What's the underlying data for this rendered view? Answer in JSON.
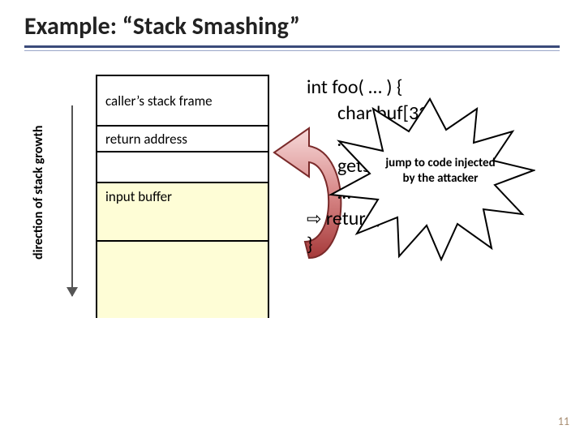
{
  "title": "Example: “Stack Smashing”",
  "axis_label": "direction of stack growth",
  "stack": {
    "caller": "caller’s stack frame",
    "return_addr": "return address",
    "input_buffer": "input buffer"
  },
  "code": {
    "l1": "int foo( … ) {",
    "l2": "char buf[32]",
    "l3": "…",
    "l4": "gets(buf);",
    "l5": "…",
    "l6_arrow": "⇨",
    "l6": " return;",
    "l7": "}"
  },
  "star_text": "jump to code injected by the attacker",
  "page_number": "11"
}
